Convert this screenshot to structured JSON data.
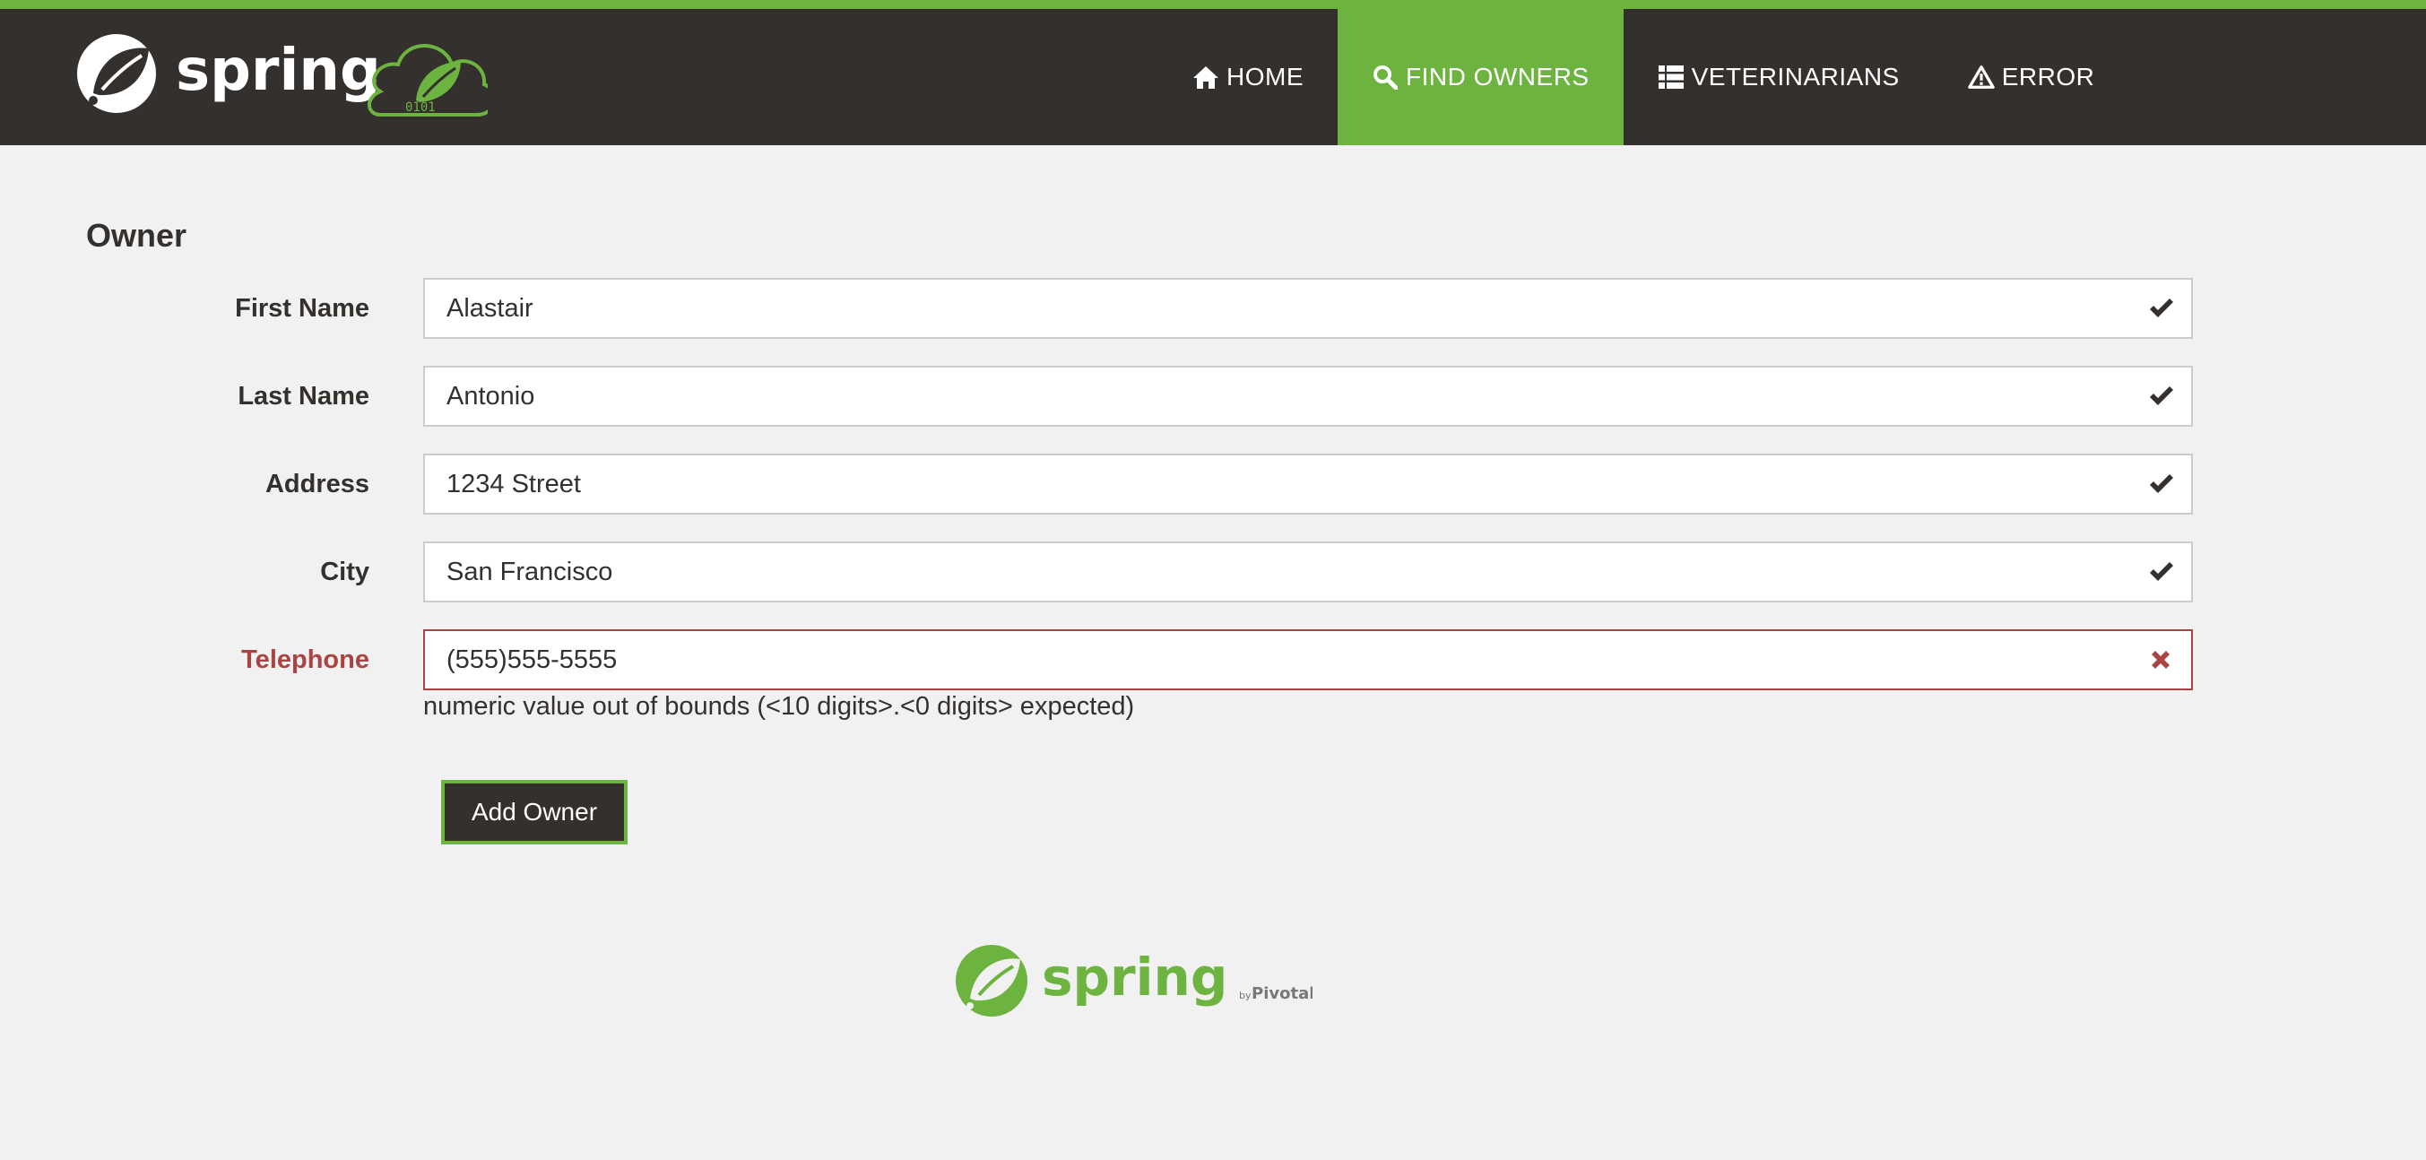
{
  "brand": {
    "name": "spring",
    "badge_text": "0101"
  },
  "nav": {
    "items": [
      {
        "label": "HOME",
        "icon": "home-icon",
        "active": false
      },
      {
        "label": "FIND OWNERS",
        "icon": "search-icon",
        "active": true
      },
      {
        "label": "VETERINARIANS",
        "icon": "list-icon",
        "active": false
      },
      {
        "label": "ERROR",
        "icon": "warning-icon",
        "active": false
      }
    ]
  },
  "page": {
    "title": "Owner"
  },
  "form": {
    "fields": [
      {
        "label": "First Name",
        "value": "Alastair",
        "status": "valid",
        "status_icon": "checkmark-icon"
      },
      {
        "label": "Last Name",
        "value": "Antonio",
        "status": "valid",
        "status_icon": "checkmark-icon"
      },
      {
        "label": "Address",
        "value": "1234 Street",
        "status": "valid",
        "status_icon": "checkmark-icon"
      },
      {
        "label": "City",
        "value": "San Francisco",
        "status": "valid",
        "status_icon": "checkmark-icon"
      },
      {
        "label": "Telephone",
        "value": "(555)555-5555",
        "status": "error",
        "status_icon": "error-x-icon"
      }
    ],
    "error_message": "numeric value out of bounds (<10 digits>.<0 digits> expected)",
    "submit_label": "Add Owner"
  },
  "footer": {
    "logo_text": "spring",
    "by_text": "by",
    "company_text": "Pivotal."
  },
  "colors": {
    "brand_green": "#6db33f",
    "dark": "#34302d",
    "background": "#f1f1f1",
    "error_red": "#a94442"
  }
}
